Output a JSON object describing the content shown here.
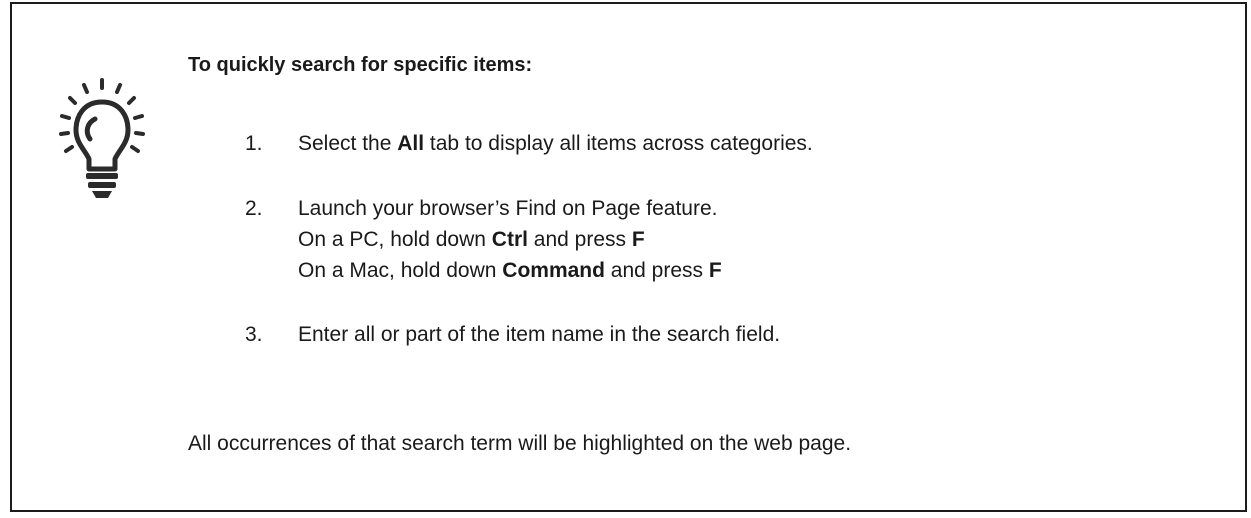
{
  "tip": {
    "icon": "lightbulb-icon",
    "heading": "To quickly search for specific items:",
    "steps": [
      {
        "number": "1.",
        "pre": "Select the ",
        "bold": "All",
        "post": " tab to display all items across categories."
      },
      {
        "number": "2.",
        "line1": "Launch your browser’s Find on Page feature.",
        "pc": {
          "pre": "On a PC, hold down ",
          "key1": "Ctrl",
          "mid": " and press ",
          "key2": "F"
        },
        "mac": {
          "pre": "On a Mac, hold down ",
          "key1": "Command",
          "mid": " and press ",
          "key2": "F"
        }
      },
      {
        "number": "3.",
        "text": "Enter all or part of the item name in the search field."
      }
    ],
    "footer": "All occurrences of that search term will be highlighted on the web page."
  }
}
